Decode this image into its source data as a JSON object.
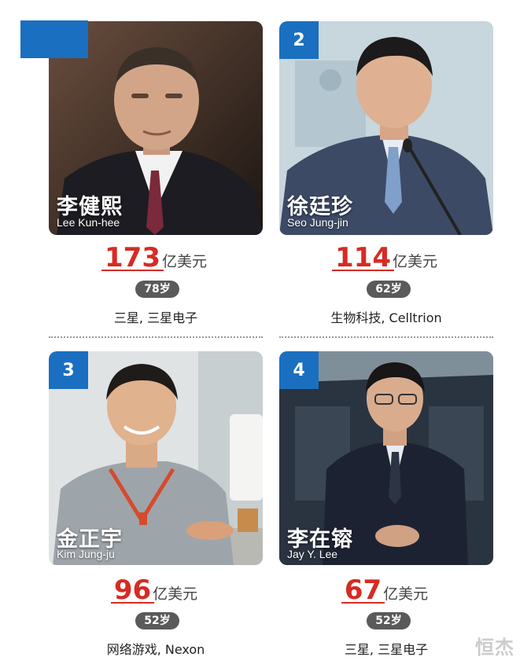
{
  "people": [
    {
      "rank": "",
      "name_zh": "李健熙",
      "name_en": "Lee Kun-hee",
      "net_worth": "173",
      "unit": "亿美元",
      "age": "78岁",
      "company": "三星, 三星电子"
    },
    {
      "rank": "2",
      "name_zh": "徐廷珍",
      "name_en": "Seo Jung-jin",
      "net_worth": "114",
      "unit": "亿美元",
      "age": "62岁",
      "company": "生物科技, Celltrion"
    },
    {
      "rank": "3",
      "name_zh": "金正宇",
      "name_en": "Kim Jung-ju",
      "net_worth": "96",
      "unit": "亿美元",
      "age": "52岁",
      "company": "网络游戏, Nexon"
    },
    {
      "rank": "4",
      "name_zh": "李在镕",
      "name_en": "Jay Y. Lee",
      "net_worth": "67",
      "unit": "亿美元",
      "age": "52岁",
      "company": "三星, 三星电子"
    }
  ],
  "watermark": "恒杰",
  "colors": {
    "accent_blue": "#1a6fc0",
    "worth_red": "#d62b24",
    "age_badge": "#5a5a5a"
  }
}
